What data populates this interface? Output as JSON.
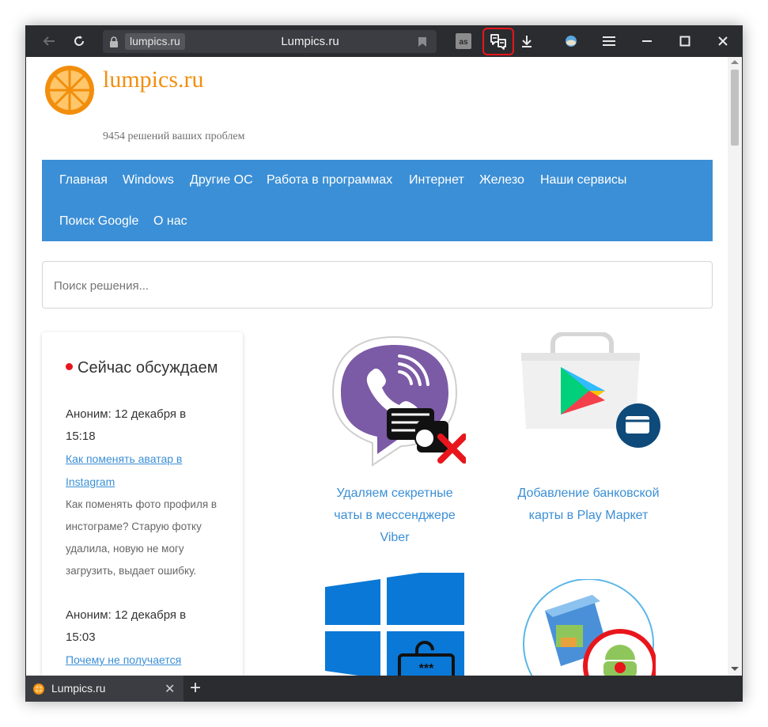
{
  "browser": {
    "address_domain": "lumpics.ru",
    "page_title": "Lumpics.ru",
    "icons": {
      "back": "arrow-left-icon",
      "reload": "reload-icon",
      "lock": "lock-icon",
      "bookmark": "bookmark-icon",
      "lastfm": "lastfm-icon",
      "reader": "reader-mode-icon",
      "download": "download-icon",
      "weather": "weather-icon",
      "menu": "hamburger-icon",
      "minimize": "minimize-icon",
      "maximize": "maximize-icon",
      "close": "close-icon"
    },
    "highlight_color": "#e8161c"
  },
  "site": {
    "name": "lumpics.ru",
    "tagline": "9454 решений ваших проблем",
    "brand_color": "#f28e0c",
    "nav_color": "#3b8fd6"
  },
  "nav": {
    "items": [
      "Главная",
      "Windows",
      "Другие ОС",
      "Работа в программах",
      "Интернет",
      "Железо",
      "Наши сервисы",
      "Поиск Google",
      "О нас"
    ]
  },
  "search": {
    "placeholder": "Поиск решения..."
  },
  "sidebar": {
    "heading": "Сейчас обсуждаем",
    "comments": [
      {
        "author": "Аноним: 12 декабря в",
        "time": "15:18",
        "link": "Как поменять аватар в Instagram",
        "excerpt": "Как поменять фото профиля в инстограме? Старую фотку удалила, новую не могу загрузить, выдает ошибку."
      },
      {
        "author": "Аноним: 12 декабря в",
        "time": "15:03",
        "link": "Почему не получается зарегистрироваться в"
      }
    ]
  },
  "cards": [
    {
      "title": "Удаляем секретные чаты в мессенджере Viber",
      "image": "viber-icon"
    },
    {
      "title": "Добавление банковской карты в Play Маркет",
      "image": "play-market-icon"
    },
    {
      "title": "",
      "image": "windows-icon"
    },
    {
      "title": "",
      "image": "android-install-icon"
    }
  ],
  "tabs": [
    {
      "title": "Lumpics.ru"
    }
  ]
}
